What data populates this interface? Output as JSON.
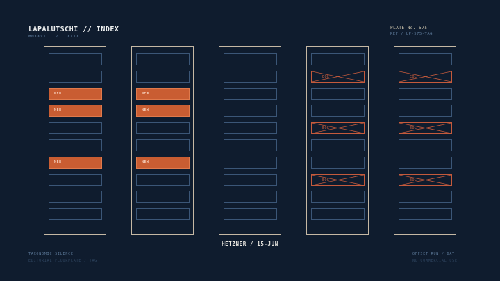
{
  "header": {
    "title": "LAPALUTSCHI // INDEX",
    "subtitle": "MMXXVI . V . XXIX",
    "plate": "PLATE No. 575",
    "ref": "REF / LP-575-TAG"
  },
  "caption": "HETZNER / 15-JUN",
  "footer": {
    "left_line1": "TAXONOMIC SILENCE",
    "left_line2": "EDITORIAL FLOORPLATE / TAG",
    "right_line1": "OFFSET RUN / DAY",
    "right_line2": "NO COMMERCIAL USE"
  },
  "labels": {
    "new": "NEW",
    "eol": "EOL"
  },
  "colors": {
    "background": "#0f1c2e",
    "rack": "#c5b8a4",
    "slot": "#3b5677",
    "new": "#c95d32",
    "eol": "#c45a3c"
  },
  "racks": [
    {
      "slots": [
        "empty",
        "empty",
        "new",
        "new",
        "empty",
        "empty",
        "new",
        "empty",
        "empty",
        "empty"
      ]
    },
    {
      "slots": [
        "empty",
        "empty",
        "new",
        "new",
        "empty",
        "empty",
        "new",
        "empty",
        "empty",
        "empty"
      ]
    },
    {
      "slots": [
        "empty",
        "empty",
        "empty",
        "empty",
        "empty",
        "empty",
        "empty",
        "empty",
        "empty",
        "empty"
      ]
    },
    {
      "slots": [
        "empty",
        "eol",
        "empty",
        "empty",
        "eol",
        "empty",
        "empty",
        "eol",
        "empty",
        "empty"
      ]
    },
    {
      "slots": [
        "empty",
        "eol",
        "empty",
        "empty",
        "eol",
        "empty",
        "empty",
        "eol",
        "empty",
        "empty"
      ]
    }
  ]
}
